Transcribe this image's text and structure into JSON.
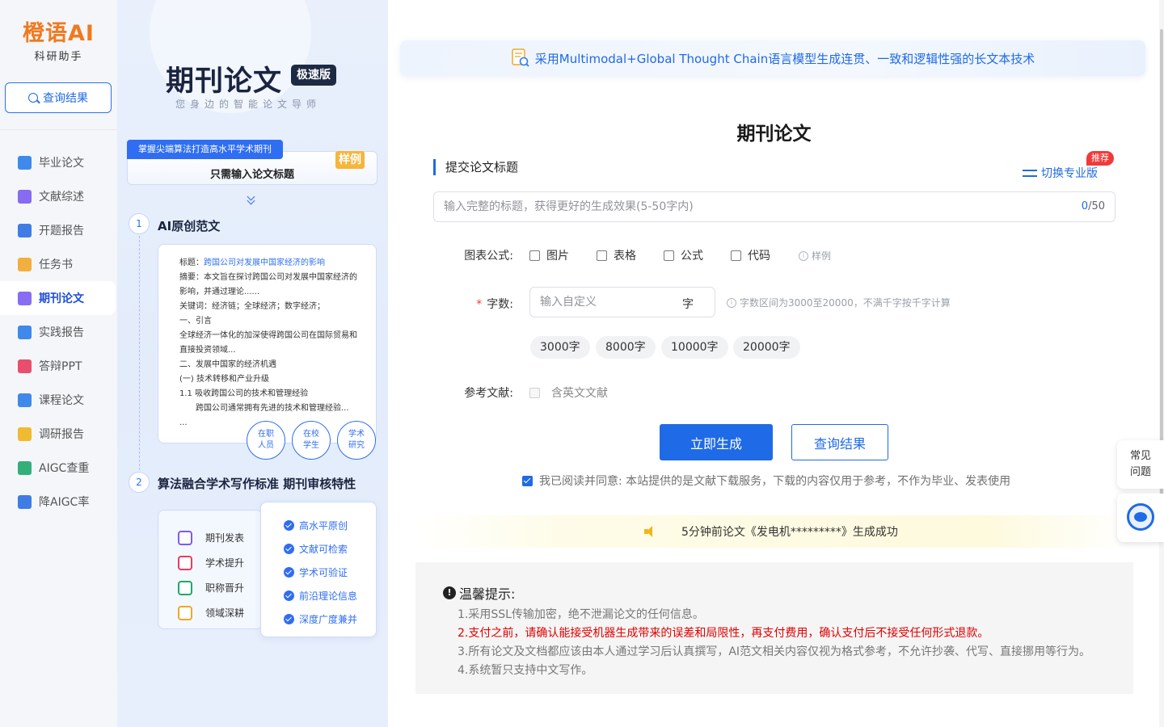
{
  "brand": {
    "name": "橙语AI",
    "subtitle": "科研助手"
  },
  "sidebar": {
    "query_button": "查询结果",
    "items": [
      {
        "label": "毕业论文",
        "icon": "graduation-cap-icon",
        "color": "#2b7de9"
      },
      {
        "label": "文献综述",
        "icon": "document-list-icon",
        "color": "#7b5cf0"
      },
      {
        "label": "开题报告",
        "icon": "stack-icon",
        "color": "#2b6fe0"
      },
      {
        "label": "任务书",
        "icon": "edit-note-icon",
        "color": "#f0a72a"
      },
      {
        "label": "期刊论文",
        "icon": "journal-icon",
        "color": "#7b5cf0",
        "active": true
      },
      {
        "label": "实践报告",
        "icon": "pen-doc-icon",
        "color": "#2b7de9"
      },
      {
        "label": "答辩PPT",
        "icon": "ppt-icon",
        "color": "#e83c5c"
      },
      {
        "label": "课程论文",
        "icon": "course-doc-icon",
        "color": "#2b7de9"
      },
      {
        "label": "调研报告",
        "icon": "clipboard-icon",
        "color": "#f0b41b"
      },
      {
        "label": "AIGC查重",
        "icon": "check-doc-icon",
        "color": "#1ea86b"
      },
      {
        "label": "降AIGC率",
        "icon": "trend-down-icon",
        "color": "#2b6fe0"
      }
    ]
  },
  "promo": {
    "title": "期刊论文",
    "badge": "极速版",
    "subtitle": "您身边的智能论文导师",
    "card1_tag": "掌握尖端算法打造高水平学术期刊",
    "card1_text": "只需输入论文标题",
    "card1_sample": "样例",
    "step1_num": "1",
    "step1_title": "AI原创范文",
    "sample_doc": {
      "title_label": "标题：",
      "title_value": "跨国公司对发展中国家经济的影响",
      "abstract": "摘要：本文旨在探讨跨国公司对发展中国家经济的影响，并通过理论......",
      "keywords": "关键词：经济链；全球经济；数字经济；",
      "s1": "一、引言",
      "s1_text": "全球经济一体化的加深使得跨国公司在国际贸易和直接投资领域...",
      "s2": "二、发展中国家的经济机遇",
      "s2_1": "(一) 技术转移和产业升级",
      "s2_1_1": "1.1  吸收跨国公司的技术和管理经验",
      "s2_1_1_text": "跨国公司通常拥有先进的技术和管理经验...",
      "ellipsis": "..."
    },
    "chips": [
      {
        "line1": "在职",
        "line2": "人员"
      },
      {
        "line1": "在校",
        "line2": "学生"
      },
      {
        "line1": "学术",
        "line2": "研究"
      }
    ],
    "step2_num": "2",
    "step2_title": "算法融合学术写作标准 期刊审核特性",
    "benefits": [
      {
        "label": "期刊发表",
        "icon": "journal-publish-icon",
        "color": "#7b5cf0"
      },
      {
        "label": "学术提升",
        "icon": "cap-icon",
        "color": "#e83c5c"
      },
      {
        "label": "职称晋升",
        "icon": "person-up-icon",
        "color": "#1ea86b"
      },
      {
        "label": "领域深耕",
        "icon": "bulb-icon",
        "color": "#f0a72a"
      }
    ],
    "features": [
      "高水平原创",
      "文献可检索",
      "学术可验证",
      "前沿理论信息",
      "深度广度兼并"
    ]
  },
  "main": {
    "banner": "采用Multimodal+Global Thought Chain语言模型生成连贯、一致和逻辑性强的长文本技术",
    "page_title": "期刊论文",
    "section_title": "提交论文标题",
    "switch_label": "切换专业版",
    "recommend_badge": "推荐",
    "title_placeholder": "输入完整的标题，获得更好的生成效果(5-50字内)",
    "counter_current": "0",
    "counter_max": "/50",
    "chart_label": "图表公式:",
    "chart_options": [
      "图片",
      "表格",
      "公式",
      "代码"
    ],
    "chart_sample": "样例",
    "word_count_label": "字数:",
    "word_count_placeholder": "输入自定义",
    "word_unit": "字",
    "word_hint": "字数区间为3000至20000，不满千字按千字计算",
    "word_presets": [
      "3000字",
      "8000字",
      "10000字",
      "20000字"
    ],
    "reference_label": "参考文献:",
    "reference_option": "含英文文献",
    "generate_button": "立即生成",
    "query_button": "查询结果",
    "agreement": "我已阅读并同意: 本站提供的是文献下载服务，下载的内容仅用于参考，不作为毕业、发表使用",
    "notice": "5分钟前论文《发电机*********》生成成功",
    "tips_title": "温馨提示:",
    "tips": [
      "1.采用SSL传输加密，绝不泄漏论文的任何信息。",
      "2.支付之前，请确认能接受机器生成带来的误差和局限性，再支付费用，确认支付后不接受任何形式退款。",
      "3.所有论文及文档都应该由本人通过学习后认真撰写，AI范文相关内容仅视为格式参考，不允许抄袭、代写、直接挪用等行为。",
      "4.系统暂只支持中文写作。"
    ]
  },
  "float": {
    "faq_line1": "常见",
    "faq_line2": "问题"
  },
  "colors": {
    "primary": "#1f6ae6",
    "brand": "#f07a1e",
    "danger": "#e00000"
  }
}
